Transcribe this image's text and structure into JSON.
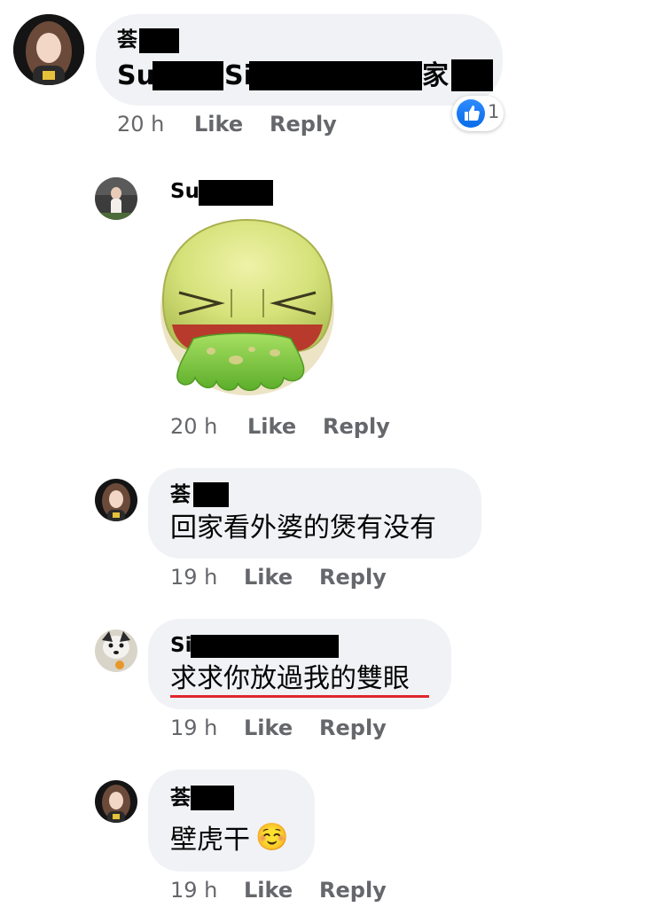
{
  "colors": {
    "bubble_bg": "#f0f2f5",
    "meta_text": "#65676b",
    "like_blue": "#1877f2",
    "underline_red": "#e0262d"
  },
  "actions": {
    "like": "Like",
    "reply": "Reply"
  },
  "comments": [
    {
      "author": "荟",
      "text_parts": [
        "Su",
        "Si",
        "家"
      ],
      "time": "20 h",
      "reaction": {
        "icon": "thumbs-up-icon",
        "count": "1"
      }
    },
    {
      "author": "Su",
      "sticker": "vomiting-face-sticker",
      "time": "20 h"
    },
    {
      "author": "荟",
      "text": "回家看外婆的煲有没有",
      "time": "19 h"
    },
    {
      "author": "Si",
      "text": "求求你放過我的雙眼",
      "time": "19 h"
    },
    {
      "author": "荟",
      "text": "壁虎干",
      "emoji": "☺️",
      "time": "19 h"
    }
  ]
}
